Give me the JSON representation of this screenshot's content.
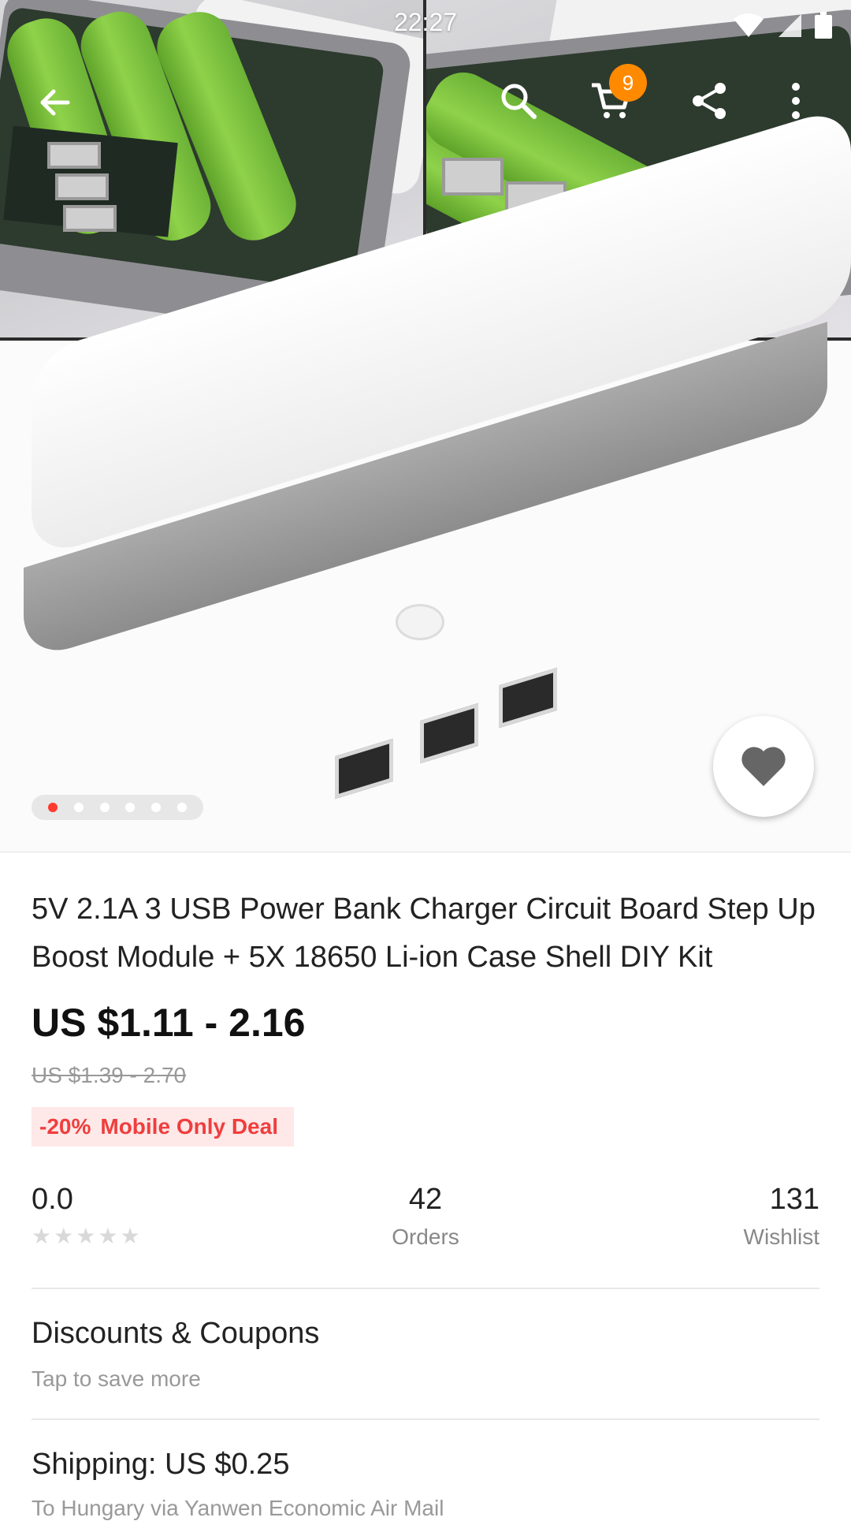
{
  "status_bar": {
    "time": "22:27"
  },
  "toolbar": {
    "back_icon": "arrow-left-icon",
    "search_icon": "search-icon",
    "cart_icon": "cart-icon",
    "cart_count": "9",
    "share_icon": "share-icon",
    "more_icon": "more-vertical-icon"
  },
  "gallery": {
    "image_count": 6,
    "active_index": 0,
    "favorite_icon": "heart-icon"
  },
  "product": {
    "title": "5V 2.1A 3 USB Power Bank Charger Circuit Board Step Up Boost Module + 5X 18650 Li-ion Case Shell DIY Kit",
    "price": "US $1.11 - 2.16",
    "original_price": "US $1.39 - 2.70",
    "deal_percent": "-20%",
    "deal_label": "Mobile Only Deal"
  },
  "stats": {
    "rating": "0.0",
    "stars": 0,
    "orders_count": "42",
    "orders_label": "Orders",
    "wishlist_count": "131",
    "wishlist_label": "Wishlist"
  },
  "discounts": {
    "title": "Discounts & Coupons",
    "subtitle": "Tap to save more"
  },
  "shipping": {
    "title": "Shipping: US $0.25",
    "subtitle": "To Hungary via Yanwen Economic Air Mail"
  },
  "colors": {
    "accent_red": "#ff3b30",
    "deal_text": "#ef3e3e",
    "badge_orange": "#ff8a00"
  }
}
